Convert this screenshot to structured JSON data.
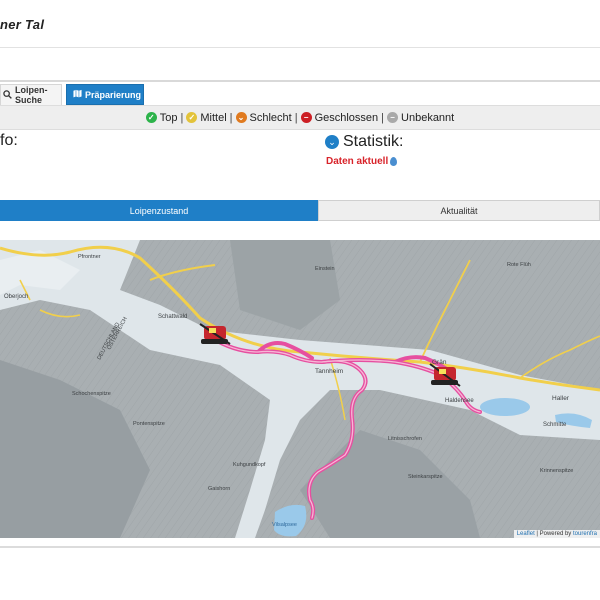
{
  "page": {
    "title": "ner Tal"
  },
  "tabs": [
    {
      "label": "Loipen-Suche",
      "icon": "search-icon"
    },
    {
      "label": "Präparierung",
      "icon": "map-icon"
    }
  ],
  "legend": [
    {
      "label": "Top",
      "color": "#2cb34a",
      "icon": "check-icon"
    },
    {
      "label": "Mittel",
      "color": "#e3c33a",
      "icon": "check-icon"
    },
    {
      "label": "Schlecht",
      "color": "#e07a1f",
      "icon": "chevron-down-icon"
    },
    {
      "label": "Geschlossen",
      "color": "#cc1f24",
      "icon": "minus-icon"
    },
    {
      "label": "Unbekannt",
      "color": "#a9a9a9",
      "icon": "minus-icon"
    }
  ],
  "info": {
    "left_heading": "fo:"
  },
  "statistik": {
    "title": "Statistik:",
    "status": "Daten aktuell"
  },
  "subtabs": [
    {
      "label": "Loipenzustand"
    },
    {
      "label": "Aktualität"
    }
  ],
  "map": {
    "colors": {
      "trail": "#e64fa0",
      "trail_core": "#f6b7d6",
      "road": "#f1cf4b",
      "water": "#9ac9ea"
    },
    "places": [
      "Oberjoch",
      "Schattwald",
      "Tannheim",
      "Grän",
      "Haldensee",
      "Haller",
      "Schmitte",
      "Vilsalpsee",
      "Gaishorn",
      "Pontenspitze",
      "Kuhgundkopf",
      "DEUTSCHLAND",
      "ÖSTERREICH",
      "Pfrontner",
      "Einstein",
      "Rote Flüh",
      "Litnisschrofen",
      "Krinnenspitze",
      "Steinkarspitze",
      "Schochenspitze"
    ],
    "attribution_leaflet": "Leaflet",
    "attribution_rest": " | Powered by ",
    "attribution_link": "tourenfra"
  }
}
